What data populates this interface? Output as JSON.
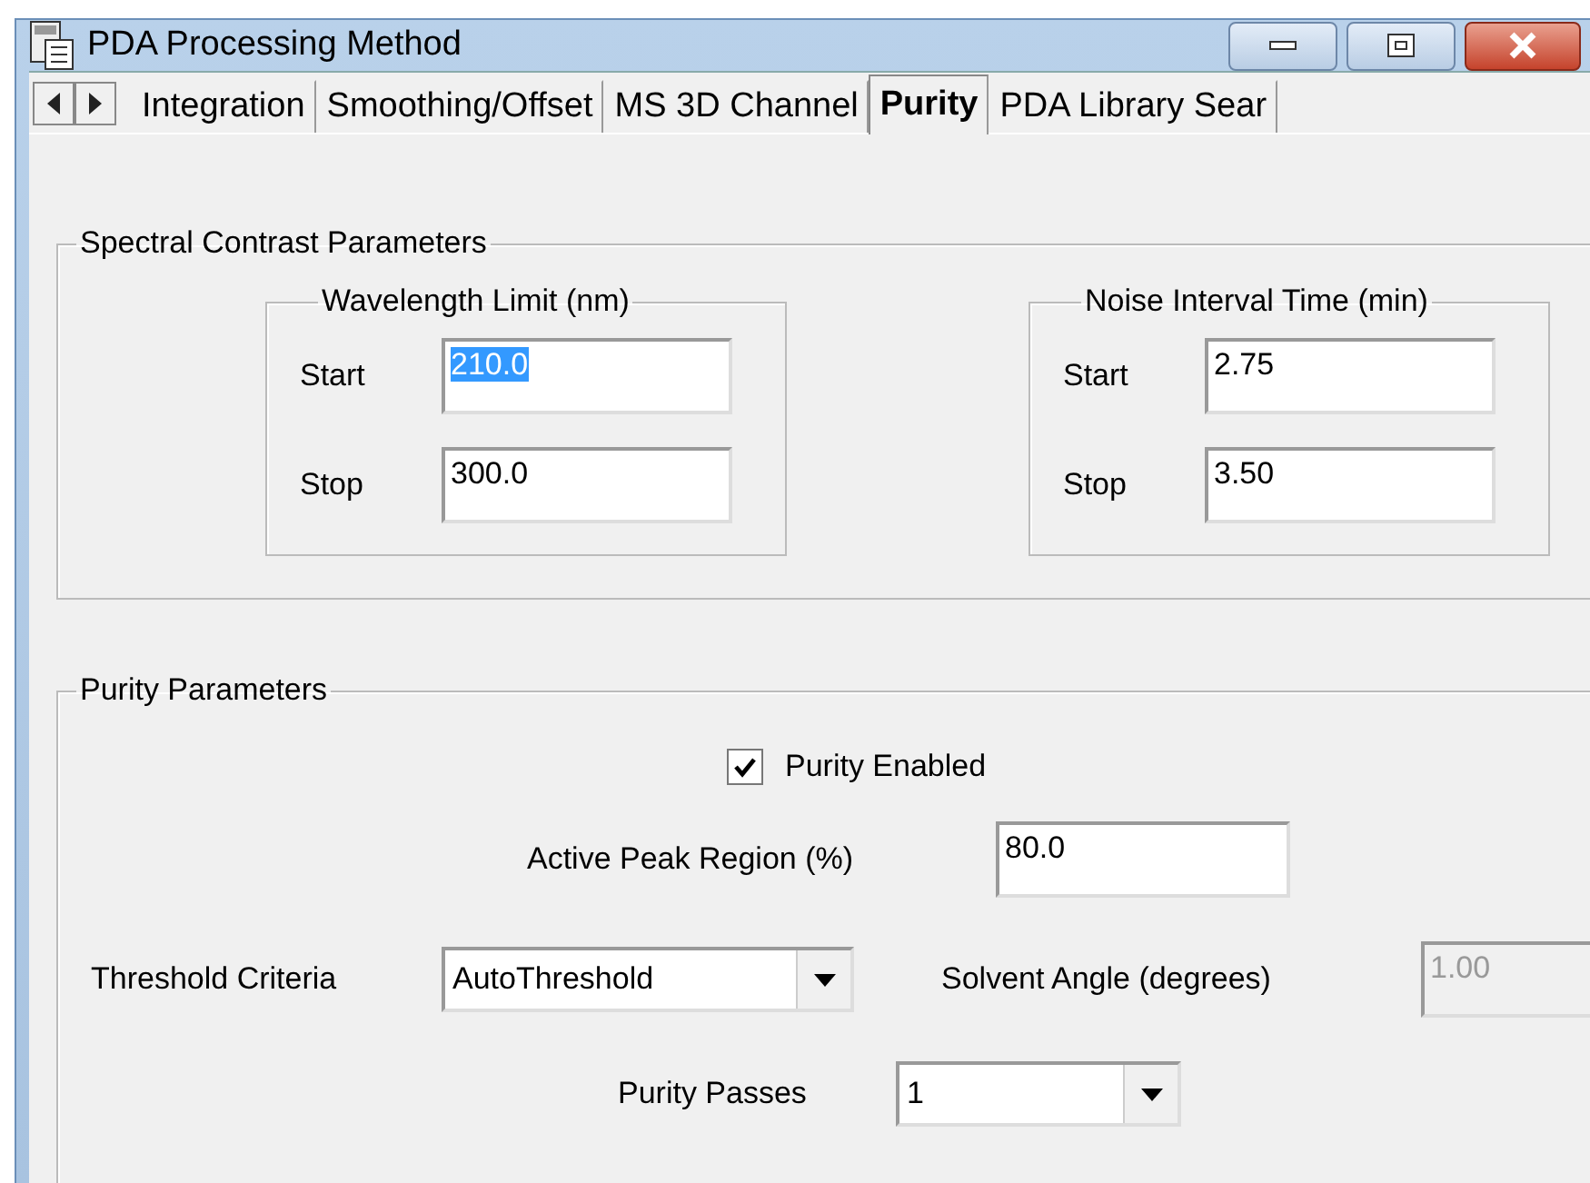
{
  "window": {
    "title": "PDA Processing Method"
  },
  "tabs": [
    {
      "label": "Integration",
      "selected": false
    },
    {
      "label": "Smoothing/Offset",
      "selected": false
    },
    {
      "label": "MS 3D Channel",
      "selected": false
    },
    {
      "label": "Purity",
      "selected": true
    },
    {
      "label": "PDA Library Sear",
      "selected": false
    }
  ],
  "spectral_contrast": {
    "title": "Spectral Contrast Parameters",
    "groups": [
      {
        "title": "Wavelength Limit (nm)",
        "fields": [
          {
            "label": "Start",
            "value": "210.0",
            "selected": true
          },
          {
            "label": "Stop",
            "value": "300.0",
            "selected": false
          }
        ]
      },
      {
        "title": "Noise Interval Time (min)",
        "fields": [
          {
            "label": "Start",
            "value": "2.75",
            "selected": false
          },
          {
            "label": "Stop",
            "value": "3.50",
            "selected": false
          }
        ]
      }
    ]
  },
  "purity": {
    "title": "Purity Parameters",
    "enabled": {
      "label": "Purity Enabled",
      "checked": true
    },
    "active_peak": {
      "label": "Active Peak Region (%)",
      "value": "80.0"
    },
    "threshold": {
      "label": "Threshold Criteria",
      "value": "AutoThreshold"
    },
    "solvent_angle": {
      "label": "Solvent Angle (degrees)",
      "value": "1.00",
      "disabled": true
    },
    "passes": {
      "label": "Purity Passes",
      "value": "1"
    }
  }
}
